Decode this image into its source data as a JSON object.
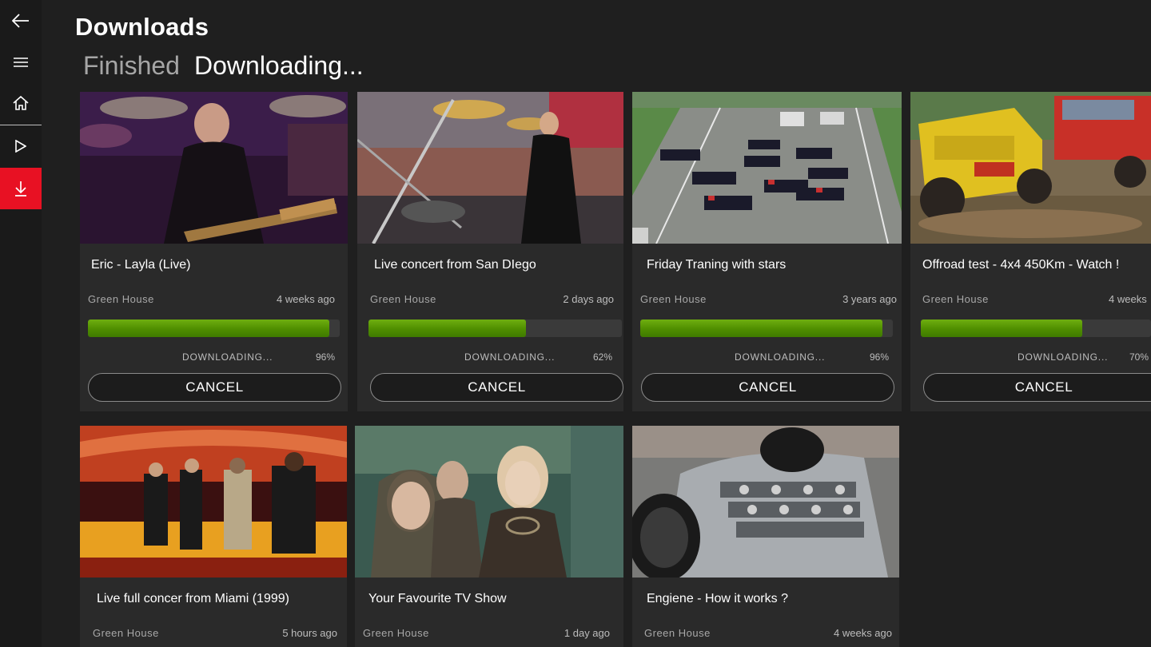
{
  "colors": {
    "accent": "#e81123",
    "progress": "#5a9a00",
    "background": "#1f1f1f"
  },
  "nav": {
    "back_icon": "back-arrow-icon",
    "menu_icon": "hamburger-menu-icon",
    "home_icon": "home-icon",
    "play_icon": "play-icon",
    "download_icon": "download-icon"
  },
  "header": {
    "title": "Downloads"
  },
  "tabs": [
    {
      "label": "Finished",
      "active": false
    },
    {
      "label": "Downloading...",
      "active": true
    }
  ],
  "downloads": [
    {
      "title": "Eric - Layla (Live)",
      "channel": "Green House",
      "time": "4 weeks ago",
      "status": "DOWNLOADING...",
      "progress_label": "96%",
      "progress": 0.96,
      "cancel": "CANCEL"
    },
    {
      "title": "Live concert from San DIego",
      "channel": "Green House",
      "time": "2 days ago",
      "status": "DOWNLOADING...",
      "progress_label": "62%",
      "progress": 0.62,
      "cancel": "CANCEL"
    },
    {
      "title": "Friday Traning with stars",
      "channel": "Green House",
      "time": "3 years ago",
      "status": "DOWNLOADING...",
      "progress_label": "96%",
      "progress": 0.96,
      "cancel": "CANCEL"
    },
    {
      "title": "Offroad test - 4x4 450Km - Watch !",
      "channel": "Green House",
      "time": "4 weeks",
      "status": "DOWNLOADING...",
      "progress_label": "70%",
      "progress": 0.7,
      "cancel": "CANCEL"
    },
    {
      "title": "Live full concer from Miami (1999)",
      "channel": "Green House",
      "time": "5 hours ago"
    },
    {
      "title": "Your Favourite TV Show",
      "channel": "Green House",
      "time": "1 day ago"
    },
    {
      "title": "Engiene - How it works ?",
      "channel": "Green House",
      "time": "4 weeks ago"
    }
  ]
}
